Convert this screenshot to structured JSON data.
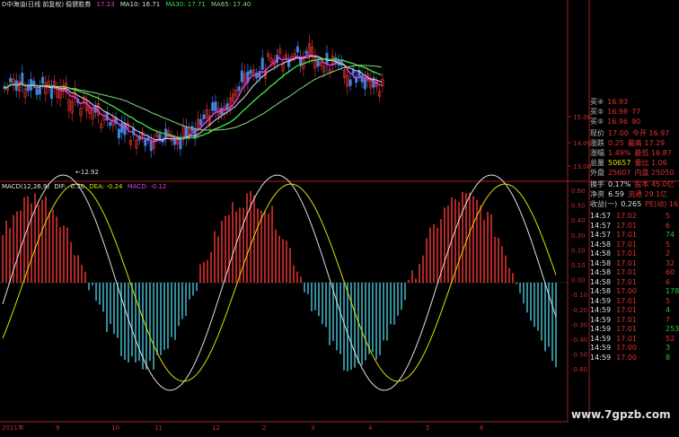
{
  "header": {
    "title": "D中海油(日线 前复权) 稳健胜券",
    "ma5_label": "17.23",
    "ma10_label": "MA10: 16.71",
    "ma30_label": "MA30: 17.71",
    "ma65_label": "MA65: 17.40"
  },
  "macd_header": {
    "name": "MACD(12,26,9)",
    "dif": "DIF: -0.30",
    "dea": "DEA: -0.24",
    "macd": "MACD: -0.12"
  },
  "low_annotation": "←12.92",
  "price_axis": [
    "15.00",
    "14.00",
    "13.00"
  ],
  "macd_axis": [
    "0.60",
    "0.50",
    "0.40",
    "0.30",
    "0.20",
    "0.10",
    "0.00",
    "-0.10",
    "-0.20",
    "-0.30",
    "-0.40",
    "-0.50",
    "-0.60"
  ],
  "date_axis": [
    "2011年",
    "9",
    "10",
    "11",
    "12",
    "2",
    "3",
    "4",
    "5",
    "6"
  ],
  "quote": {
    "rows": [
      {
        "l": "买④",
        "v": "16.93",
        "r": "",
        "lc": "#c0c0c0",
        "vc": "#e03030"
      },
      {
        "l": "买⑤",
        "v": "16.98",
        "r": "77",
        "lc": "#c0c0c0",
        "vc": "#e03030"
      },
      {
        "l": "买⑤",
        "v": "16.96",
        "r": "90",
        "lc": "#c0c0c0",
        "vc": "#e03030"
      },
      {
        "l": "现价",
        "v": "17.00",
        "r": "今开 16.97",
        "lc": "#c0c0c0",
        "vc": "#e03030"
      },
      {
        "l": "涨跌",
        "v": "0.25",
        "r": "最高 17.29",
        "lc": "#c0c0c0",
        "vc": "#e03030"
      },
      {
        "l": "涨幅",
        "v": "1.49%",
        "r": "最低 16.87",
        "lc": "#c0c0c0",
        "vc": "#e03030"
      },
      {
        "l": "总量",
        "v": "50657",
        "r": "量比 1.06",
        "lc": "#c0c0c0",
        "vc": "#e0e000"
      },
      {
        "l": "外盘",
        "v": "25607",
        "r": "内盘 25050",
        "lc": "#c0c0c0",
        "vc": "#e03030"
      },
      {
        "l": "换手",
        "v": "0.17%",
        "r": "股本 45.0亿",
        "lc": "#c0c0c0",
        "vc": "#e0e0e0"
      },
      {
        "l": "净资",
        "v": "6.59",
        "r": "流通 29.1亿",
        "lc": "#c0c0c0",
        "vc": "#e0e0e0"
      },
      {
        "l": "收益(一)",
        "v": "0.265",
        "r": "PE(动) 16.0",
        "lc": "#c0c0c0",
        "vc": "#e0e0e0"
      }
    ],
    "ticks": [
      {
        "t": "14:57",
        "p": "17.02",
        "v": "5",
        "c": "#e03030"
      },
      {
        "t": "14:57",
        "p": "17.01",
        "v": "6",
        "c": "#e03030"
      },
      {
        "t": "14:57",
        "p": "17.01",
        "v": "74",
        "c": "#30c030"
      },
      {
        "t": "14:58",
        "p": "17.01",
        "v": "5",
        "c": "#e03030"
      },
      {
        "t": "14:58",
        "p": "17.01",
        "v": "2",
        "c": "#e03030"
      },
      {
        "t": "14:58",
        "p": "17.01",
        "v": "32",
        "c": "#e03030"
      },
      {
        "t": "14:58",
        "p": "17.01",
        "v": "60",
        "c": "#e03030"
      },
      {
        "t": "14:58",
        "p": "17.01",
        "v": "6",
        "c": "#e03030"
      },
      {
        "t": "14:58",
        "p": "17.00",
        "v": "178",
        "c": "#30c030"
      },
      {
        "t": "14:59",
        "p": "17.01",
        "v": "5",
        "c": "#e03030"
      },
      {
        "t": "14:59",
        "p": "17.01",
        "v": "4",
        "c": "#30c030"
      },
      {
        "t": "14:59",
        "p": "17.01",
        "v": "7",
        "c": "#e03030"
      },
      {
        "t": "14:59",
        "p": "17.01",
        "v": "253",
        "c": "#30c030"
      },
      {
        "t": "14:59",
        "p": "17.01",
        "v": "52",
        "c": "#e03030"
      },
      {
        "t": "14:59",
        "p": "17.00",
        "v": "3",
        "c": "#30c030"
      },
      {
        "t": "14:59",
        "p": "17.00",
        "v": "8",
        "c": "#30c030"
      }
    ]
  },
  "watermark": "www.7gpzb.com",
  "colors": {
    "ma5": "#e040e0",
    "ma10": "#40e040",
    "ma30": "#80e080",
    "ma65": "#60c060",
    "up": "#e03030",
    "down": "#4080e0",
    "hist_up": "#e03030",
    "hist_down": "#40b0c0",
    "grid": "#a02020"
  }
}
